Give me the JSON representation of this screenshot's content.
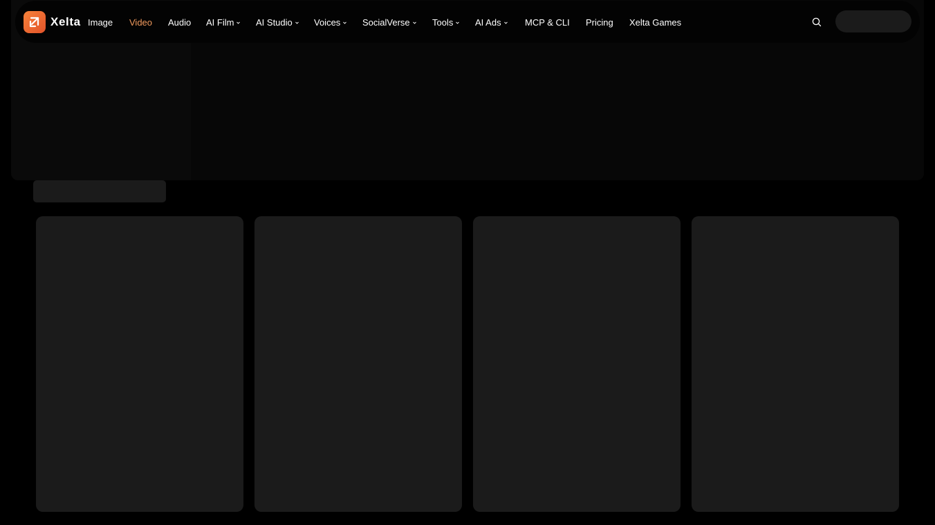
{
  "brand": {
    "name": "Xelta",
    "logo_icon": "xelta-logo-icon",
    "accent_color": "#f7823a"
  },
  "nav": {
    "items": [
      {
        "label": "Image",
        "has_dropdown": false,
        "active": false
      },
      {
        "label": "Video",
        "has_dropdown": false,
        "active": true
      },
      {
        "label": "Audio",
        "has_dropdown": false,
        "active": false
      },
      {
        "label": "AI Film",
        "has_dropdown": true,
        "active": false
      },
      {
        "label": "AI Studio",
        "has_dropdown": true,
        "active": false
      },
      {
        "label": "Voices",
        "has_dropdown": true,
        "active": false
      },
      {
        "label": "SocialVerse",
        "has_dropdown": true,
        "active": false
      },
      {
        "label": "Tools",
        "has_dropdown": true,
        "active": false
      },
      {
        "label": "AI Ads",
        "has_dropdown": true,
        "active": false
      },
      {
        "label": "MCP & CLI",
        "has_dropdown": false,
        "active": false
      },
      {
        "label": "Pricing",
        "has_dropdown": false,
        "active": false
      },
      {
        "label": "Xelta Games",
        "has_dropdown": false,
        "active": false
      }
    ],
    "active_color": "#f19a5d",
    "search_icon": "search-icon",
    "dropdown_icon": "chevron-down-icon"
  },
  "content": {
    "state": "loading-skeleton",
    "card_count": 4
  }
}
